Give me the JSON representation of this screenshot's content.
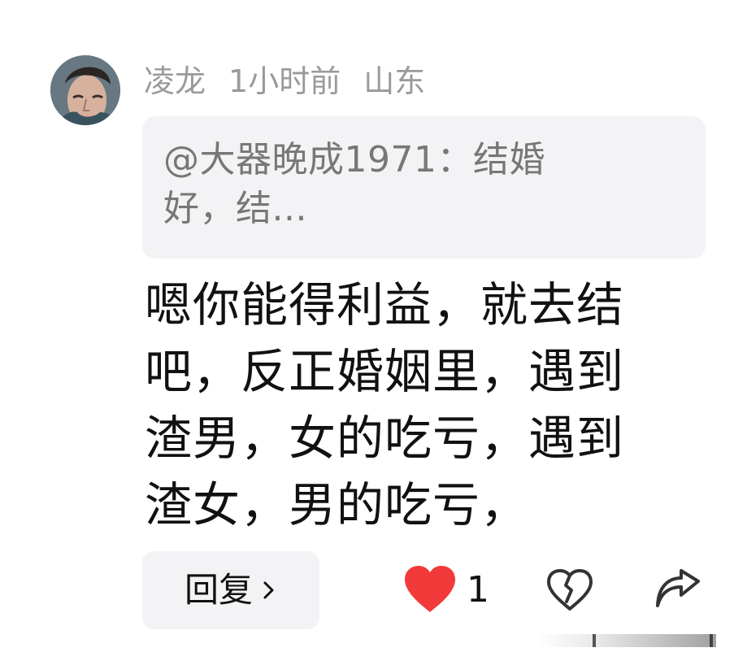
{
  "user": {
    "name": "凌龙",
    "time": "1小时前",
    "location": "山东"
  },
  "quote": {
    "lines": [
      "@大器晚成1971：结婚",
      "好，结..."
    ]
  },
  "comment": {
    "lines": [
      "嗯你能得利益，就去结",
      "吧，反正婚姻里，遇到",
      "渣男，女的吃亏，遇到",
      "渣女，男的吃亏，"
    ]
  },
  "actions": {
    "reply_label": "回复",
    "like_count": "1"
  },
  "colors": {
    "like": "#f23a3a",
    "meta_text": "#9a9a9a",
    "quote_bg": "#f3f3f5",
    "quote_text": "#777777"
  },
  "icons": {
    "reply_chevron": "chevron-right-icon",
    "like": "heart-icon",
    "dislike": "broken-heart-icon",
    "share": "share-arrow-icon"
  }
}
